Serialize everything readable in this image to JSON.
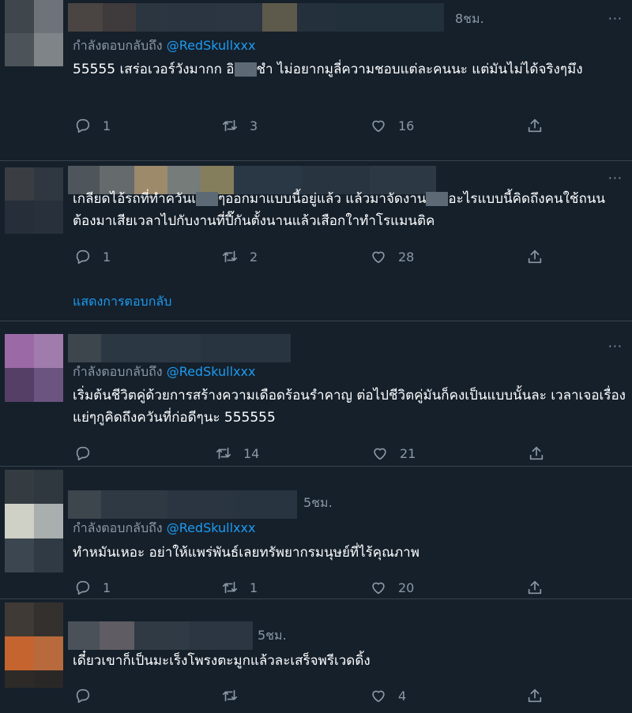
{
  "colors": {
    "background": "#15202b",
    "accent": "#1d9bf0",
    "muted": "#8b98a5",
    "divider": "#38444d"
  },
  "icons": {
    "reply": "reply-icon",
    "retweet": "retweet-icon",
    "like": "heart-icon",
    "share": "share-icon",
    "more": "more-dots-icon"
  },
  "more_glyph": "···",
  "tweets": [
    {
      "time": "8ชม.",
      "reply_prefix": "กำลังตอบกลับถึง",
      "reply_handle": "@RedSkullxxx",
      "text_a": "55555 เสร่อเวอร์วังมากก อิ",
      "text_b": "ชำ ไม่อยากมูลี่ความชอบแต่ละคนนะ แต่มันไม่ได้จริงๆมึง",
      "replies": "1",
      "retweets": "3",
      "likes": "16"
    },
    {
      "text_a": "เกลียดไอ้รถที่ทำควันเ",
      "text_b": "ๆออกมาแบบนี้อยู่แล้ว แล้วมาจัดงาน",
      "text_c": "อะไรแบบนี้คิดถึงคนใช้ถนนต้องมาเสียเวลาไปกับงานที่ปี๊กันตั้งนานแล้วเสือกใาทำโรแมนติค",
      "replies": "1",
      "retweets": "2",
      "likes": "28",
      "show_replies": "แสดงการตอบกลับ"
    },
    {
      "reply_prefix": "กำลังตอบกลับถึง",
      "reply_handle": "@RedSkullxxx",
      "text": "เริ่มต้นชีวิตคู่ด้วยการสร้างความเดือดร้อนรำคาญ ต่อไปชีวิตคู่มันก็คงเป็นแบบนั้นละ เวลาเจอเรื่องแย่ๆกูคิดถึงควันที่ก่อดีๆนะ 555555",
      "retweets": "14",
      "likes": "21"
    },
    {
      "time": "5ชม.",
      "reply_prefix": "กำลังตอบกลับถึง",
      "reply_handle": "@RedSkullxxx",
      "text": "ทำหมันเหอะ  อย่าให้แพร่พันธ์เลยทรัพยากรมนุษย์ที่ไร้คุณภาพ",
      "replies": "1",
      "retweets": "1",
      "likes": "20"
    },
    {
      "time": "5ชม.",
      "text": "เดี๋ยวเขาก็เป็นมะเร็งโพรงตะมูกแล้วละเสร็จพรีเวดดิ้ง",
      "likes": "4"
    }
  ]
}
